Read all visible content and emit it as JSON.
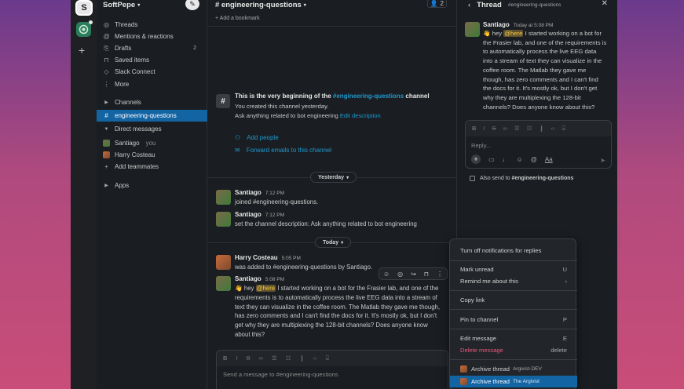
{
  "workspace": {
    "initial": "S",
    "name": "SoftPepe",
    "add": "+"
  },
  "sidebar": {
    "nav": [
      {
        "label": "Threads",
        "icon": "threads-icon",
        "glyph": "◎"
      },
      {
        "label": "Mentions & reactions",
        "icon": "at-icon",
        "glyph": "@"
      },
      {
        "label": "Drafts",
        "icon": "drafts-icon",
        "glyph": "⎘",
        "count": "2"
      },
      {
        "label": "Saved items",
        "icon": "bookmark-icon",
        "glyph": "⊓"
      },
      {
        "label": "Slack Connect",
        "icon": "connect-icon",
        "glyph": "◇"
      },
      {
        "label": "More",
        "icon": "more-icon",
        "glyph": "⋮"
      }
    ],
    "channels_header": "Channels",
    "active_channel": "engineering-questions",
    "dm_header": "Direct messages",
    "dms": [
      {
        "name": "Santiago",
        "suffix": "you"
      },
      {
        "name": "Harry Costeau"
      }
    ],
    "add_teammates": "Add teammates",
    "apps": "Apps"
  },
  "channel": {
    "title": "# engineering-questions",
    "members": "2",
    "bookmark": "Add a bookmark",
    "intro_prefix": "This is the very beginning of the ",
    "intro_link": "#engineering-questions",
    "intro_suffix": " channel",
    "created": "You created this channel yesterday.",
    "desc": "Ask anything related to bot engineering ",
    "desc_link": "Edit description",
    "add_people": "Add people",
    "forward": "Forward emails to this channel",
    "yesterday": "Yesterday",
    "today": "Today",
    "composer_placeholder": "Send a message to #engineering-questions"
  },
  "messages": [
    {
      "name": "Santiago",
      "time": "7:12 PM",
      "text": "joined #engineering-questions."
    },
    {
      "name": "Santiago",
      "time": "7:12 PM",
      "text": "set the channel description: Ask anything related to bot engineering"
    },
    {
      "name": "Harry Costeau",
      "time": "5:05 PM",
      "text": "was added to #engineering-questions by Santiago."
    },
    {
      "name": "Santiago",
      "time": "5:08 PM",
      "wave": "👋 hey ",
      "mention": "@here",
      "lines": [
        " I started working on a bot for the Frasier lab, and one of the",
        "requirements is to automatically process the live EEG data into a stream of",
        "text they can visualize in the coffee room. The Matlab they gave me though,",
        "has zero comments and I can't find the docs for it. It's mostly ok, but I don't",
        "get why they are multiplexing the 128-bit channels? Does anyone know",
        "about this?"
      ]
    }
  ],
  "thread": {
    "title": "Thread",
    "channel": "#engineering-questions",
    "name": "Santiago",
    "time": "Today at 5:08 PM",
    "wave": "👋 hey ",
    "mention": "@here",
    "lines": [
      " I started working on a bot for",
      "the Frasier lab, and one of the requirements is",
      "to automatically process the live EEG data",
      "into a stream of text they can visualize in the",
      "coffee room. The Matlab they gave me",
      "though, has zero comments and I can't find",
      "the docs for it. It's mostly ok, but I don't get",
      "why they are multiplexing the 128-bit",
      "channels? Does anyone know about this?"
    ],
    "reply_placeholder": "Reply...",
    "also_send_prefix": "Also send to ",
    "also_send_channel": "#engineering-questions"
  },
  "menu": {
    "turn_off": "Turn off notifications for replies",
    "mark_unread": "Mark unread",
    "mark_unread_key": "U",
    "remind": "Remind me about this",
    "remind_key": "›",
    "copy_link": "Copy link",
    "pin": "Pin to channel",
    "pin_key": "P",
    "edit": "Edit message",
    "edit_key": "E",
    "delete": "Delete message",
    "delete_key": "delete",
    "archive1": "Archive thread",
    "archive1_org": "Argivist-DEV",
    "archive2": "Archive thread",
    "archive2_org": "The Argivist"
  },
  "colors": {
    "accent": "#1264a3",
    "link": "#1d9bd1",
    "danger": "#e8587e",
    "mention": "#f2c744"
  }
}
